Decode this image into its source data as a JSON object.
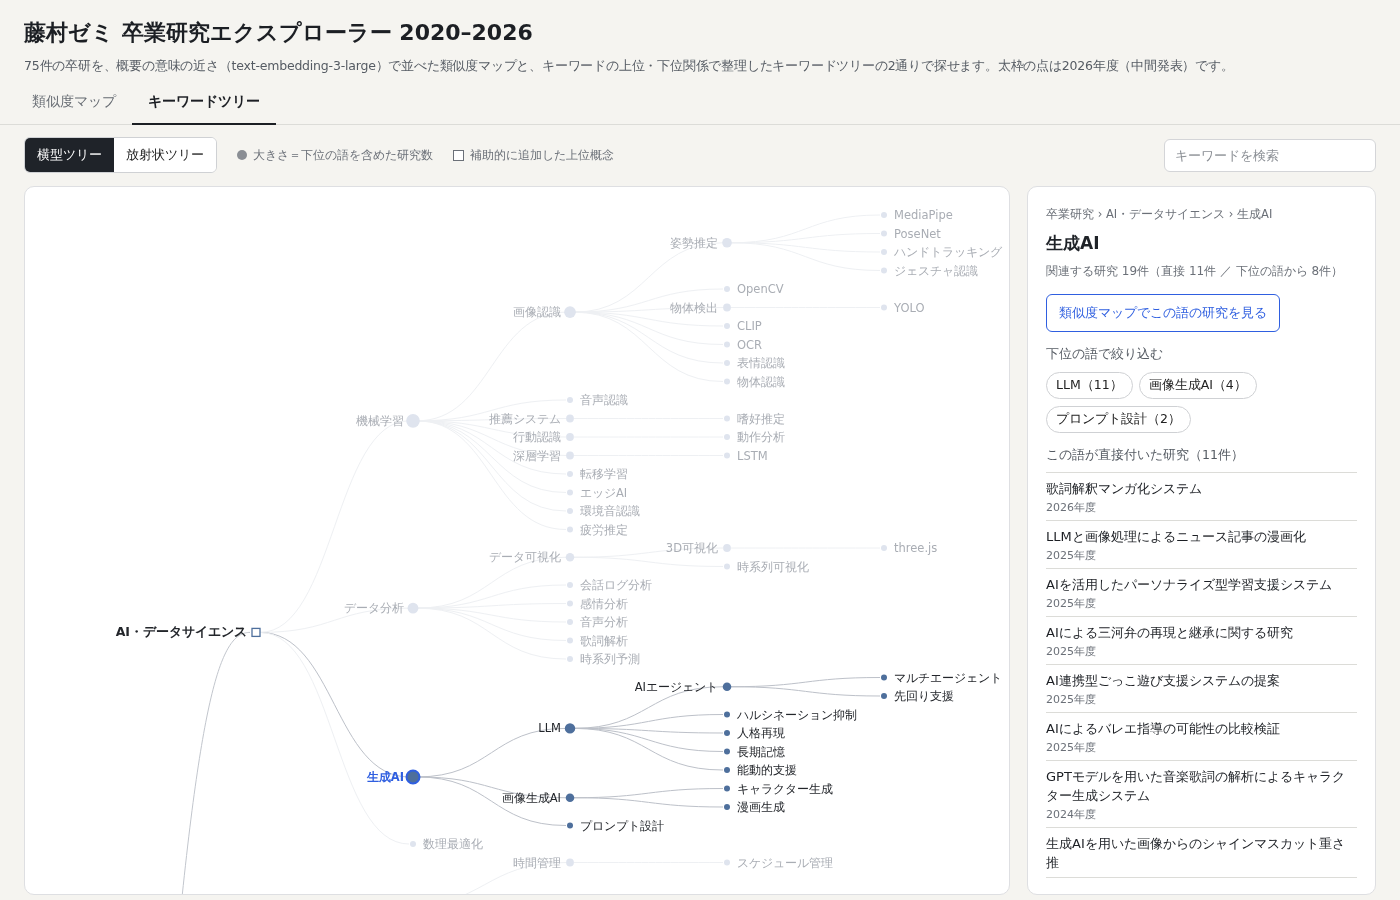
{
  "header": {
    "title": "藤村ゼミ 卒業研究エクスプローラー 2020–2026",
    "subtitle": "75件の卒研を、概要の意味の近さ（text-embedding-3-large）で並べた類似度マップと、キーワードの上位・下位関係で整理したキーワードツリーの2通りで探せます。太枠の点は2026年度（中間発表）です。"
  },
  "tabs": [
    {
      "label": "類似度マップ",
      "selected": false
    },
    {
      "label": "キーワードツリー",
      "selected": true
    }
  ],
  "view_toggle": [
    {
      "label": "横型ツリー",
      "selected": true
    },
    {
      "label": "放射状ツリー",
      "selected": false
    }
  ],
  "legend": [
    {
      "kind": "dot",
      "label": "大きさ＝下位の語を含めた研究数"
    },
    {
      "kind": "square",
      "label": "補助的に追加した上位概念"
    }
  ],
  "search": {
    "placeholder": "キーワードを検索"
  },
  "tree": {
    "incoming_link": true,
    "root": {
      "label": "AI・データサイエンス",
      "auxiliary": true,
      "selected": false,
      "children": [
        {
          "label": "機械学習",
          "auxiliary": false,
          "selected": false,
          "children": [
            {
              "label": "画像認識",
              "auxiliary": false,
              "selected": false,
              "children": [
                {
                  "label": "姿勢推定",
                  "auxiliary": false,
                  "selected": false,
                  "children": [
                    {
                      "label": "MediaPipe",
                      "auxiliary": false,
                      "selected": false
                    },
                    {
                      "label": "PoseNet",
                      "auxiliary": false,
                      "selected": false
                    },
                    {
                      "label": "ハンドトラッキング",
                      "auxiliary": false,
                      "selected": false
                    },
                    {
                      "label": "ジェスチャ認識",
                      "auxiliary": false,
                      "selected": false
                    }
                  ]
                },
                {
                  "label": "OpenCV",
                  "auxiliary": false,
                  "selected": false
                },
                {
                  "label": "物体検出",
                  "auxiliary": false,
                  "selected": false,
                  "children": [
                    {
                      "label": "YOLO",
                      "auxiliary": false,
                      "selected": false
                    }
                  ]
                },
                {
                  "label": "CLIP",
                  "auxiliary": false,
                  "selected": false
                },
                {
                  "label": "OCR",
                  "auxiliary": false,
                  "selected": false
                },
                {
                  "label": "表情認識",
                  "auxiliary": false,
                  "selected": false
                },
                {
                  "label": "物体認識",
                  "auxiliary": false,
                  "selected": false
                }
              ]
            },
            {
              "label": "音声認識",
              "auxiliary": false,
              "selected": false
            },
            {
              "label": "推薦システム",
              "auxiliary": false,
              "selected": false,
              "children": [
                {
                  "label": "嗜好推定",
                  "auxiliary": false,
                  "selected": false
                }
              ]
            },
            {
              "label": "行動認識",
              "auxiliary": false,
              "selected": false,
              "children": [
                {
                  "label": "動作分析",
                  "auxiliary": false,
                  "selected": false
                }
              ]
            },
            {
              "label": "深層学習",
              "auxiliary": false,
              "selected": false,
              "children": [
                {
                  "label": "LSTM",
                  "auxiliary": false,
                  "selected": false
                }
              ]
            },
            {
              "label": "転移学習",
              "auxiliary": false,
              "selected": false
            },
            {
              "label": "エッジAI",
              "auxiliary": false,
              "selected": false
            },
            {
              "label": "環境音認識",
              "auxiliary": false,
              "selected": false
            },
            {
              "label": "疲労推定",
              "auxiliary": false,
              "selected": false
            }
          ]
        },
        {
          "label": "データ分析",
          "auxiliary": false,
          "selected": false,
          "children": [
            {
              "label": "データ可視化",
              "auxiliary": false,
              "selected": false,
              "children": [
                {
                  "label": "3D可視化",
                  "auxiliary": false,
                  "selected": false,
                  "children": [
                    {
                      "label": "three.js",
                      "auxiliary": false,
                      "selected": false
                    }
                  ]
                },
                {
                  "label": "時系列可視化",
                  "auxiliary": false,
                  "selected": false
                }
              ]
            },
            {
              "label": "会話ログ分析",
              "auxiliary": false,
              "selected": false
            },
            {
              "label": "感情分析",
              "auxiliary": false,
              "selected": false
            },
            {
              "label": "音声分析",
              "auxiliary": false,
              "selected": false
            },
            {
              "label": "歌詞解析",
              "auxiliary": false,
              "selected": false
            },
            {
              "label": "時系列予測",
              "auxiliary": false,
              "selected": false
            }
          ]
        },
        {
          "label": "生成AI",
          "auxiliary": false,
          "selected": true,
          "children": [
            {
              "label": "LLM",
              "auxiliary": false,
              "selected": false,
              "children": [
                {
                  "label": "AIエージェント",
                  "auxiliary": false,
                  "selected": false,
                  "children": [
                    {
                      "label": "マルチエージェント",
                      "auxiliary": false,
                      "selected": false
                    },
                    {
                      "label": "先回り支援",
                      "auxiliary": false,
                      "selected": false
                    }
                  ]
                },
                {
                  "label": "ハルシネーション抑制",
                  "auxiliary": false,
                  "selected": false
                },
                {
                  "label": "人格再現",
                  "auxiliary": false,
                  "selected": false
                },
                {
                  "label": "長期記憶",
                  "auxiliary": false,
                  "selected": false
                },
                {
                  "label": "能動的支援",
                  "auxiliary": false,
                  "selected": false
                }
              ]
            },
            {
              "label": "画像生成AI",
              "auxiliary": false,
              "selected": false,
              "children": [
                {
                  "label": "キャラクター生成",
                  "auxiliary": false,
                  "selected": false
                },
                {
                  "label": "漫画生成",
                  "auxiliary": false,
                  "selected": false
                }
              ]
            },
            {
              "label": "プロンプト設計",
              "auxiliary": false,
              "selected": false
            }
          ]
        },
        {
          "label": "数理最適化",
          "auxiliary": false,
          "selected": false
        }
      ]
    },
    "trailing": [
      {
        "label": "時間管理",
        "auxiliary": false,
        "selected": false,
        "children": [
          {
            "label": "スケジュール管理",
            "auxiliary": false,
            "selected": false
          }
        ]
      }
    ]
  },
  "detail": {
    "breadcrumb": "卒業研究 › AI・データサイエンス › 生成AI",
    "title": "生成AI",
    "summary": "関連する研究 19件（直接 11件 ／ 下位の語から 8件）",
    "map_button": "類似度マップでこの語の研究を見る",
    "filter_heading": "下位の語で絞り込む",
    "chips": [
      "LLM（11）",
      "画像生成AI（4）",
      "プロンプト設計（2）"
    ],
    "studies_heading": "この語が直接付いた研究（11件）",
    "studies": [
      {
        "title": "歌詞解釈マンガ化システム",
        "year": "2026年度"
      },
      {
        "title": "LLMと画像処理によるニュース記事の漫画化",
        "year": "2025年度"
      },
      {
        "title": "AIを活用したパーソナライズ型学習支援システム",
        "year": "2025年度"
      },
      {
        "title": "AIによる三河弁の再現と継承に関する研究",
        "year": "2025年度"
      },
      {
        "title": "AI連携型ごっこ遊び支援システムの提案",
        "year": "2025年度"
      },
      {
        "title": "AIによるバレエ指導の可能性の比較検証",
        "year": "2025年度"
      },
      {
        "title": "GPTモデルを用いた音楽歌詞の解析によるキャラクター生成システム",
        "year": "2024年度"
      },
      {
        "title": "生成AIを用いた画像からのシャインマスカット重さ推"
      }
    ]
  }
}
